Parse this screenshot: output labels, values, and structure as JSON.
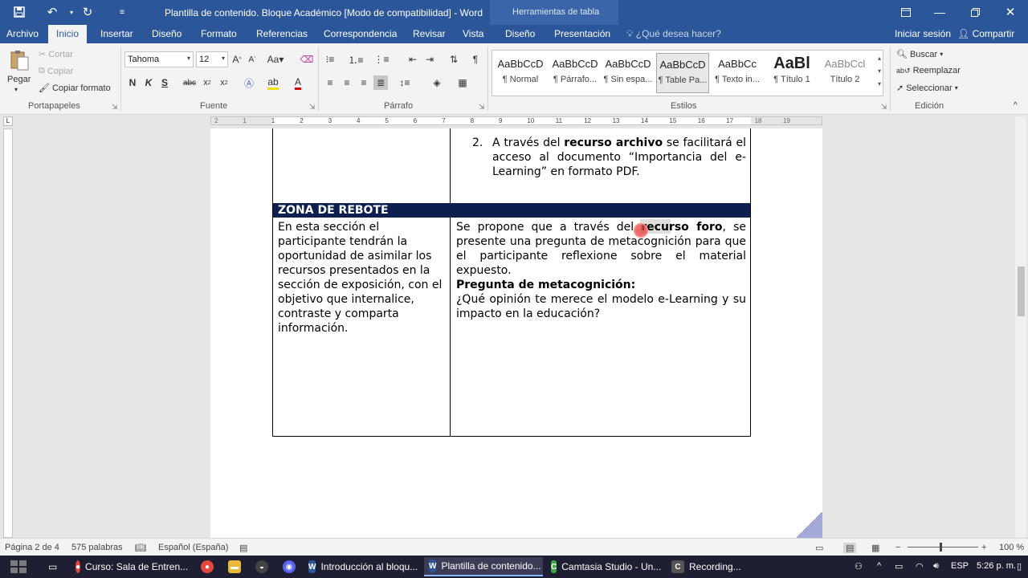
{
  "titlebar": {
    "document_title": "Plantilla de contenido. Bloque Académico [Modo de compatibilidad] - Word",
    "contextual_tab": "Herramientas de tabla"
  },
  "tabs": {
    "archivo": "Archivo",
    "inicio": "Inicio",
    "insertar": "Insertar",
    "diseno": "Diseño",
    "formato": "Formato",
    "referencias": "Referencias",
    "correspondencia": "Correspondencia",
    "revisar": "Revisar",
    "vista": "Vista",
    "diseno_tabla": "Diseño",
    "presentacion": "Presentación",
    "tell_me": "¿Qué desea hacer?",
    "sign_in": "Iniciar sesión",
    "share": "Compartir"
  },
  "ribbon": {
    "clipboard": {
      "paste": "Pegar",
      "cut": "Cortar",
      "copy": "Copiar",
      "format_painter": "Copiar formato",
      "label": "Portapapeles"
    },
    "font": {
      "font_name": "Tahoma",
      "font_size": "12",
      "label": "Fuente"
    },
    "paragraph": {
      "label": "Párrafo"
    },
    "styles": {
      "label": "Estilos",
      "items": [
        {
          "sample": "AaBbCcD",
          "name": "¶ Normal"
        },
        {
          "sample": "AaBbCcD",
          "name": "¶ Párrafo..."
        },
        {
          "sample": "AaBbCcD",
          "name": "¶ Sin espa..."
        },
        {
          "sample": "AaBbCcD",
          "name": "¶ Table Pa..."
        },
        {
          "sample": "AaBbCc",
          "name": "¶ Texto in..."
        },
        {
          "sample": "AaBl",
          "name": "¶ Título 1"
        },
        {
          "sample": "AaBbCcl",
          "name": "Título 2"
        }
      ]
    },
    "editing": {
      "find": "Buscar",
      "replace": "Reemplazar",
      "select": "Seleccionar",
      "label": "Edición"
    }
  },
  "ruler": {
    "ticks": [
      "2",
      "1",
      "1",
      "2",
      "3",
      "4",
      "5",
      "6",
      "7",
      "8",
      "9",
      "10",
      "11",
      "12",
      "13",
      "14",
      "15",
      "16",
      "17",
      "18",
      "19"
    ]
  },
  "document": {
    "list_item": {
      "number": "2.",
      "pre": "A través del ",
      "bold": "recurso archivo",
      "post": " se facilitará el acceso al documento “Importancia del e-Learning” en formato PDF."
    },
    "section_title": "ZONA DE REBOTE",
    "left_cell": "En esta sección el participante tendrán la oportunidad de asimilar los recursos presentados en la sección de exposición, con el objetivo que internalice, contraste y comparta información.",
    "right_cell": {
      "pre": "Se propone que a través del ",
      "bold": "recurso foro",
      "post": ", se presente una pregunta de metacognición para que el participante reflexione sobre el material expuesto.",
      "question_title": "Pregunta de metacognición:",
      "question": "¿Qué opinión te merece el modelo e-Learning y su impacto en la educación?"
    }
  },
  "statusbar": {
    "page": "Página 2 de 4",
    "words": "575 palabras",
    "language": "Español (España)",
    "zoom": "100 %"
  },
  "taskbar": {
    "items": [
      {
        "label": "Curso: Sala de Entren...",
        "color": "#e8453c"
      },
      {
        "label": "Introducción al bloqu...",
        "color": "#2b579a"
      },
      {
        "label": "Plantilla de contenido...",
        "color": "#2b579a"
      },
      {
        "label": "Camtasia Studio - Un...",
        "color": "#3aa845"
      },
      {
        "label": "Recording...",
        "color": "#555555"
      }
    ],
    "language": "ESP",
    "time": "5:26 p. m."
  }
}
